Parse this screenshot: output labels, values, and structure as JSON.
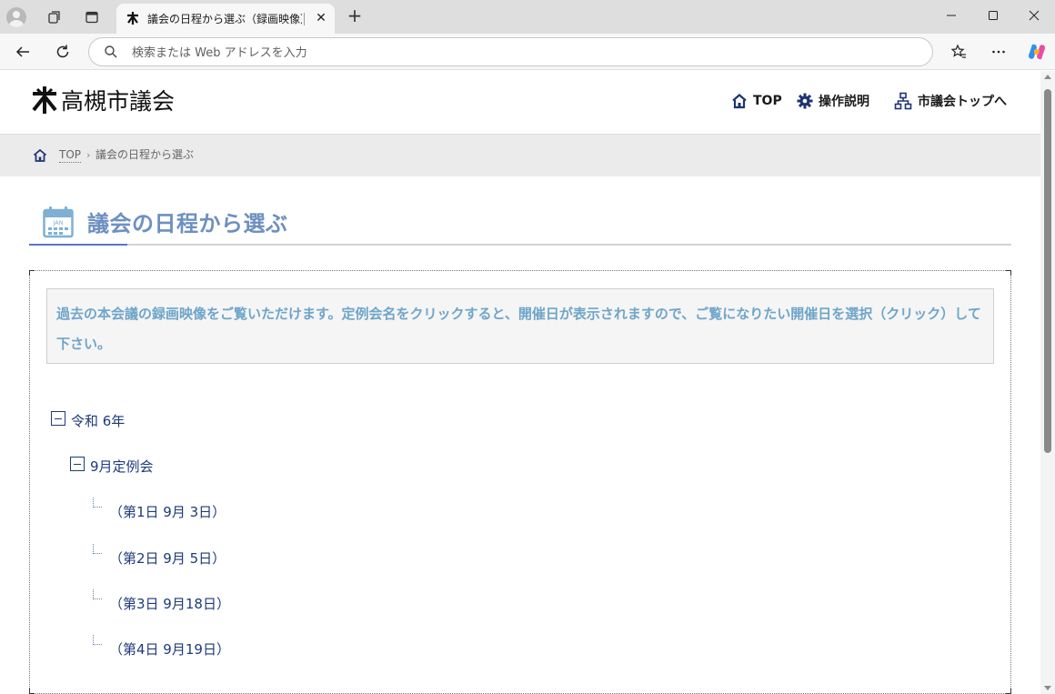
{
  "browser": {
    "tab_title": "議会の日程から選ぶ（録画映像）",
    "address_placeholder": "検索または Web アドレスを入力",
    "icons": [
      "profile-icon",
      "workspaces-icon",
      "tab-actions-icon",
      "back-icon",
      "refresh-icon",
      "search-icon",
      "favorites-icon",
      "more-icon",
      "copilot-icon",
      "minimize-icon",
      "maximize-icon",
      "close-icon"
    ]
  },
  "header": {
    "site_name": "高槻市議会",
    "nav": [
      {
        "label": "TOP",
        "icon": "home-icon"
      },
      {
        "label": "操作説明",
        "icon": "gear-icon"
      },
      {
        "label": "市議会トップへ",
        "icon": "sitemap-icon"
      }
    ]
  },
  "breadcrumb": {
    "items": [
      "TOP",
      "議会の日程から選ぶ"
    ],
    "separator": "›"
  },
  "main": {
    "title": "議会の日程から選ぶ",
    "calendar_label": "JAN",
    "notice": "過去の本会議の録画映像をご覧いただけます。定例会名をクリックすると、開催日が表示されますので、ご覧になりたい開催日を選択（クリック）して下さい。",
    "tree": {
      "year": "令和 6年",
      "session": "9月定例会",
      "days": [
        "（第1日 9月 3日）",
        "（第2日 9月 5日）",
        "（第3日 9月18日）",
        "（第4日 9月19日）"
      ]
    }
  },
  "colors": {
    "title": "#6d90c0",
    "notice_text": "#6fa5c9",
    "tree_text": "#1d3a7a",
    "accent_line": "#5a74c4",
    "breadcrumb_bg": "#ebebeb"
  }
}
